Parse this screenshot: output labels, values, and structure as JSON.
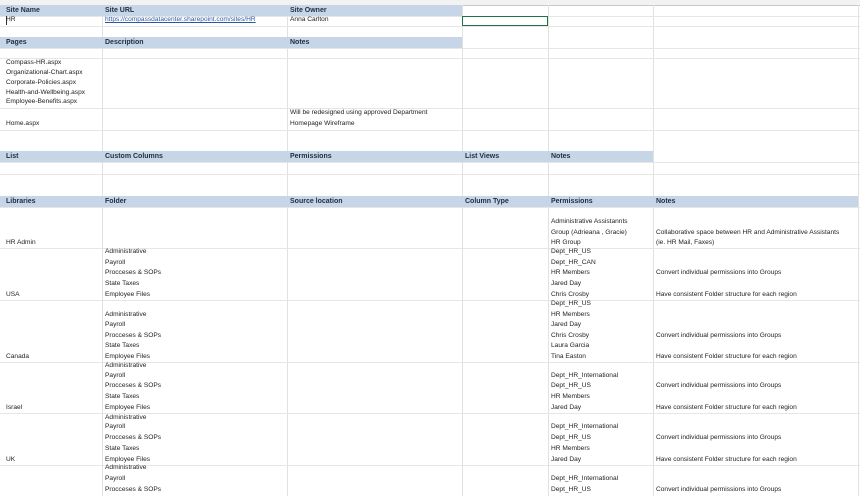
{
  "site": {
    "headers": [
      "Site Name",
      "Site URL",
      "Site Owner"
    ],
    "name": "HR",
    "url": "https://compassdatacenter.sharepoint.com/sites/HR",
    "owner": "Anna Carlton"
  },
  "pages": {
    "headers": [
      "Pages",
      "Description",
      "Notes"
    ],
    "items": [
      "Compass-HR.aspx",
      "Organizational-Chart.aspx",
      "Corporate-Policies.aspx",
      "Health-and-Wellbeing.aspx",
      "Employee-Benefits.aspx"
    ],
    "home": "Home.aspx",
    "home_note_1": "Will be redesigned using approved Department",
    "home_note_2": "Homepage Wireframe"
  },
  "list": {
    "headers": [
      "List",
      "Custom Columns",
      "Permissions",
      "List Views",
      "Notes"
    ]
  },
  "libraries": {
    "headers": [
      "Libraries",
      "Folder",
      "Source location",
      "Column Type",
      "Permissions",
      "Notes"
    ],
    "hr_admin": {
      "name": "HR Admin",
      "perms": [
        "Administrative Assistannts",
        "Group (Adrieana , Gracie)",
        "HR Group"
      ],
      "note_1": "Collaborative space between HR and Administrative Assistants",
      "note_2": "(ie. HR Mail, Faxes)"
    },
    "folders": [
      "Administrative",
      "Payroll",
      "Procceses & SOPs",
      "State Taxes",
      "Employee Files"
    ],
    "note_convert": "Convert individual permissions into Groups",
    "note_consistent": "Have consistent Folder structure for each region",
    "usa": {
      "name": "USA",
      "perms": [
        "Dept_HR_US",
        "Dept_HR_CAN",
        "HR Members",
        "Jared Day",
        "Chris Crosby"
      ]
    },
    "canada": {
      "name": "Canada",
      "perms": [
        "Dept_HR_US",
        "HR Members",
        "Jared Day",
        "Chris Crosby",
        "Laura Garcia",
        "Tina Easton"
      ]
    },
    "israel": {
      "name": "Israel",
      "perms": [
        "Dept_HR_International",
        "Dept_HR_US",
        "HR Members",
        "Jared Day"
      ]
    },
    "uk": {
      "name": "UK",
      "perms": [
        "Dept_HR_International",
        "Dept_HR_US",
        "HR Members",
        "Jared Day"
      ]
    },
    "next": {
      "perms": [
        "Dept_HR_International",
        "Dept_HR_US"
      ]
    }
  }
}
